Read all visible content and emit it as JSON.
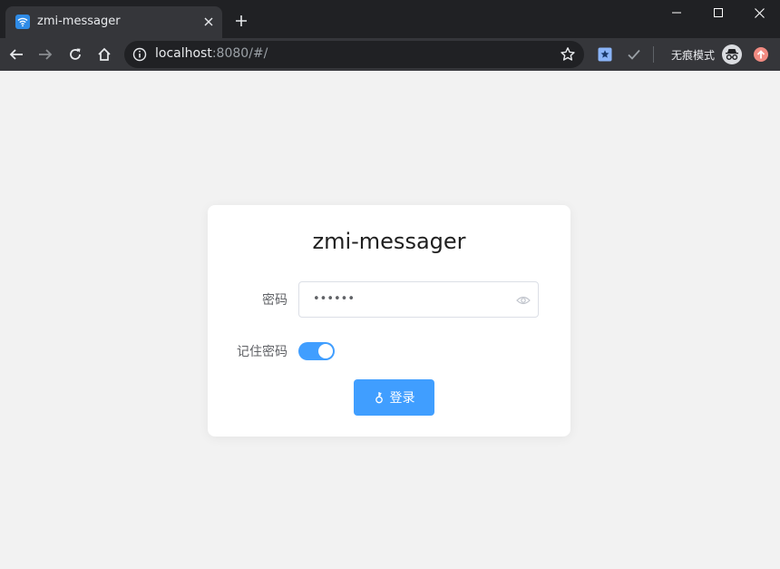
{
  "browser": {
    "tab_title": "zmi-messager",
    "url_host": "localhost",
    "url_rest": ":8080/#/",
    "incognito_label": "无痕模式"
  },
  "login": {
    "title": "zmi-messager",
    "password_label": "密码",
    "password_masked": "••••••",
    "remember_label": "记住密码",
    "remember_enabled": true,
    "login_button_label": "登录"
  },
  "colors": {
    "accent": "#409eff",
    "page_bg": "#f2f2f2",
    "chrome_dark": "#202124",
    "chrome_toolbar": "#35363a"
  }
}
